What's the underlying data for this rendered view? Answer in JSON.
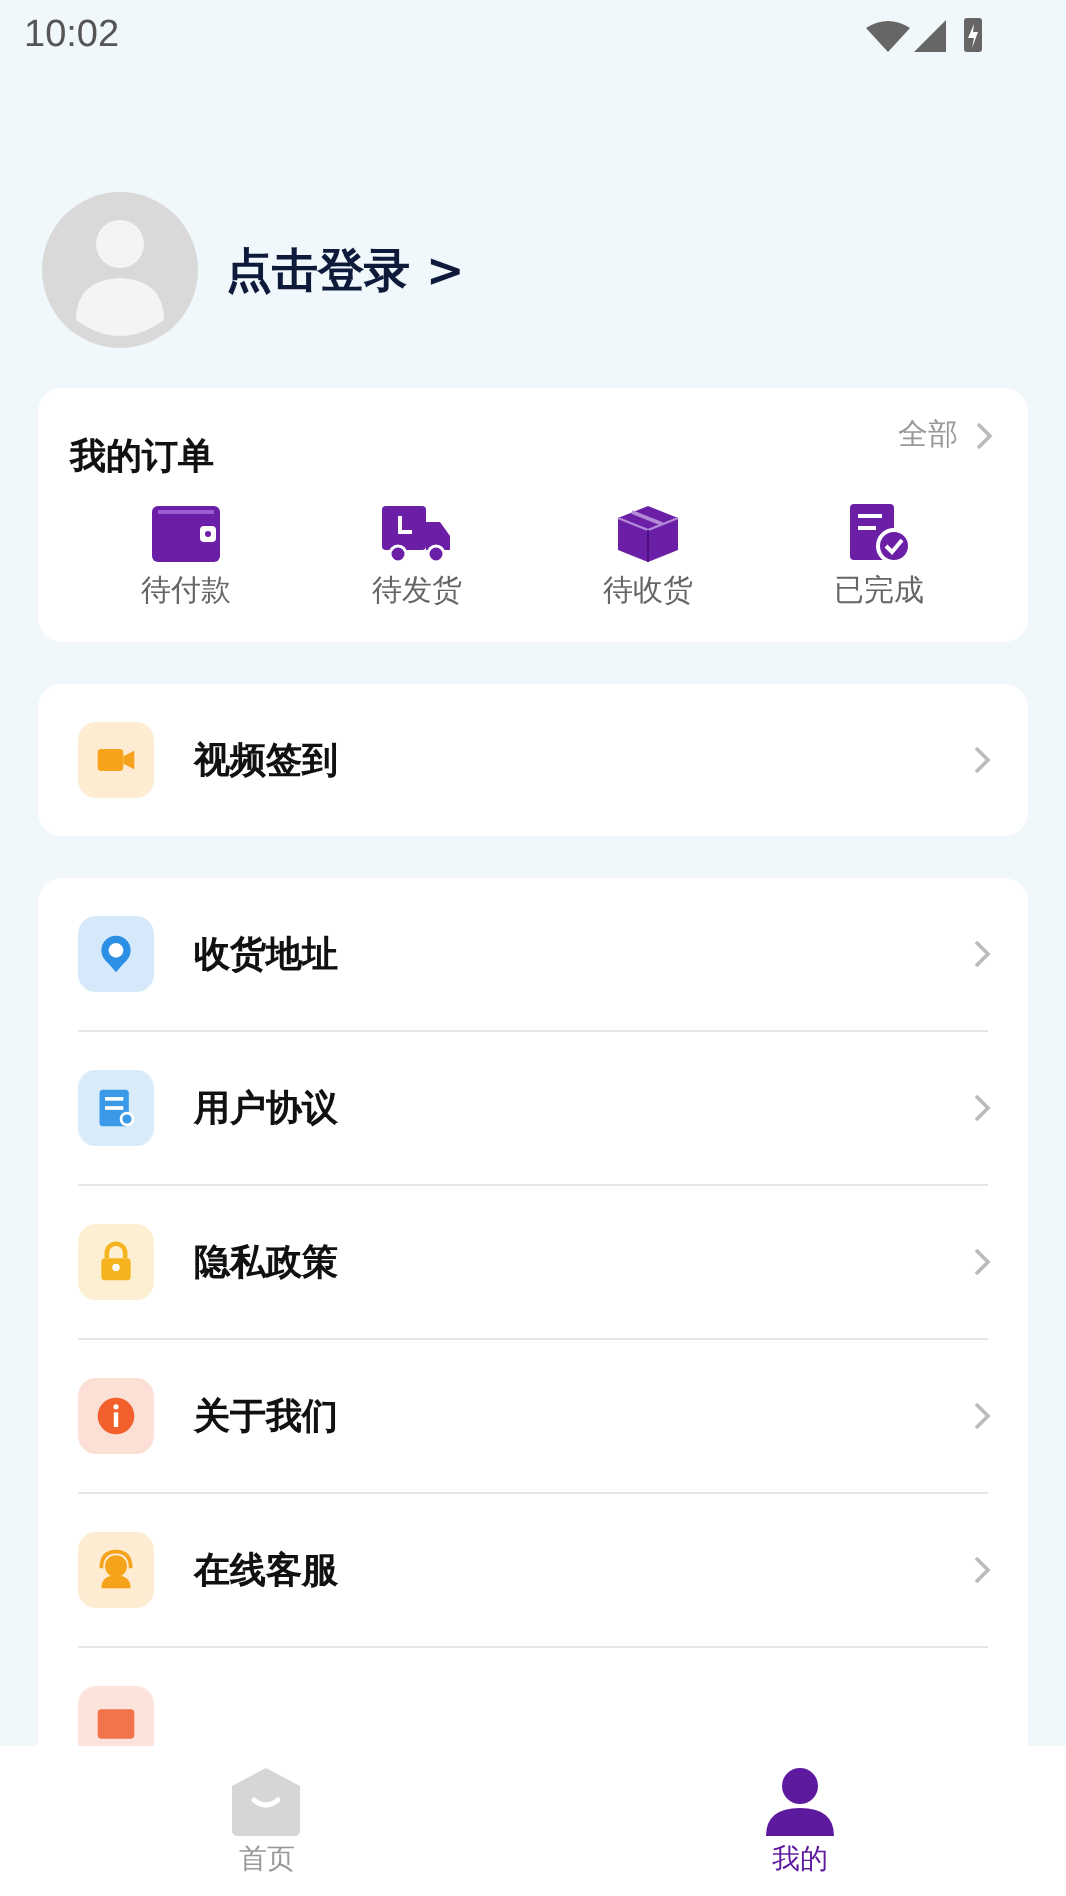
{
  "status_bar": {
    "time": "10:02"
  },
  "profile": {
    "login_text": "点击登录 >"
  },
  "orders": {
    "title": "我的订单",
    "all_link": "全部",
    "items": [
      {
        "label": "待付款",
        "kind": "wallet"
      },
      {
        "label": "待发货",
        "kind": "truck"
      },
      {
        "label": "待收货",
        "kind": "box"
      },
      {
        "label": "已完成",
        "kind": "done"
      }
    ]
  },
  "video_checkin": {
    "label": "视频签到",
    "kind": "video",
    "color": "#f7a21b"
  },
  "menu": [
    {
      "label": "收货地址",
      "kind": "location",
      "color": "#2b8fe6"
    },
    {
      "label": "用户协议",
      "kind": "document",
      "color": "#3a9ae8"
    },
    {
      "label": "隐私政策",
      "kind": "lock",
      "color": "#f5b320"
    },
    {
      "label": "关于我们",
      "kind": "info",
      "color": "#f2602e"
    },
    {
      "label": "在线客服",
      "kind": "service",
      "color": "#f7a21b"
    },
    {
      "kind": "card",
      "color": "#f2744a"
    }
  ],
  "tab_bar": [
    {
      "label": "首页",
      "kind": "home",
      "selected": false
    },
    {
      "label": "我的",
      "kind": "person",
      "selected": true
    }
  ]
}
